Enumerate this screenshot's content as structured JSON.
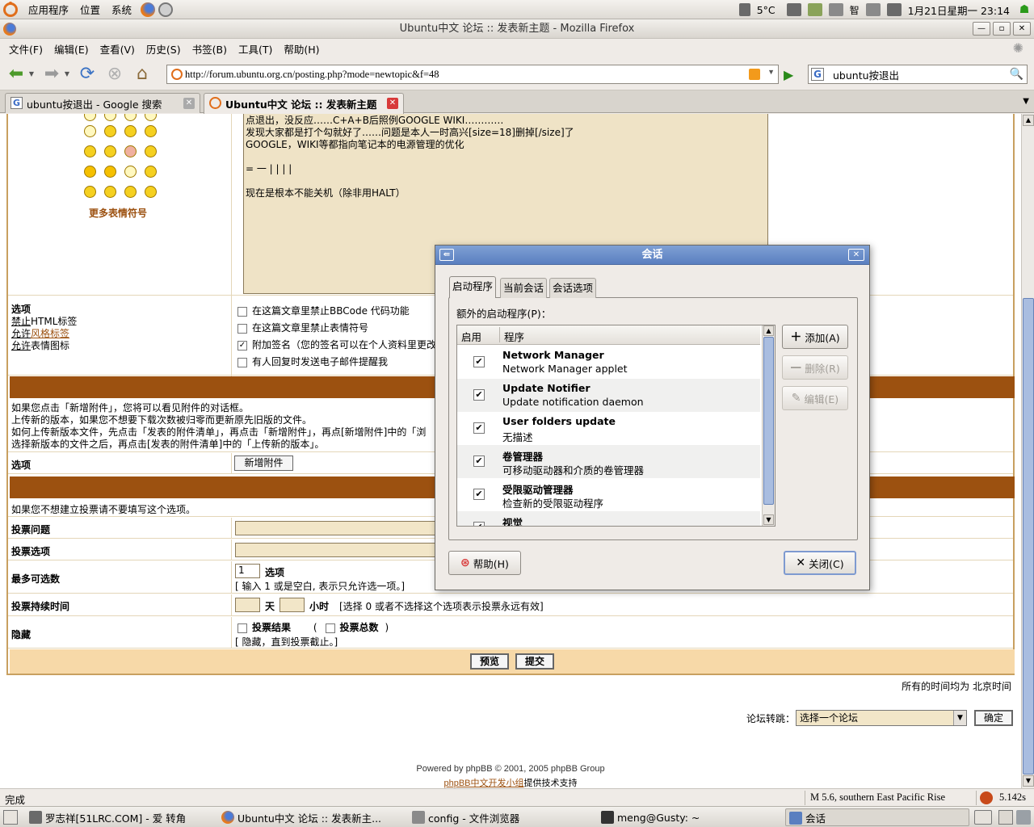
{
  "panel": {
    "menus": [
      "应用程序",
      "位置",
      "系统"
    ],
    "temperature": "5°C",
    "clock": "1月21日星期一 23:14"
  },
  "firefox": {
    "title": "Ubuntu中文 论坛 :: 发表新主题 - Mozilla Firefox",
    "menus": [
      "文件(F)",
      "编辑(E)",
      "查看(V)",
      "历史(S)",
      "书签(B)",
      "工具(T)",
      "帮助(H)"
    ],
    "url": "http://forum.ubuntu.org.cn/posting.php?mode=newtopic&f=48",
    "search_value": "ubuntu按退出",
    "tabs": [
      {
        "label": "ubuntu按退出 - Google 搜索",
        "active": false
      },
      {
        "label": "Ubuntu中文 论坛 :: 发表新主题",
        "active": true
      }
    ],
    "status": "完成",
    "status_quake": "M 5.6, southern East Pacific Rise",
    "status_timer": "5.142s"
  },
  "page": {
    "more_smilies": "更多表情符号",
    "editor_lines": [
      "点退出，没反应……C+A+B后照例GOOGLE WIKI…………",
      "发现大家都是打个勾就好了……问题是本人一时高兴[size=18]删掉[/size]了",
      "GOOGLE，WIKI等都指向笔记本的电源管理的优化",
      "",
      "= 一 | | | |",
      "",
      "现在是根本不能关机（除非用HALT）"
    ],
    "options_label": "选项",
    "html_disabled": "禁止",
    "html_label": "HTML标签",
    "bbcode_enabled": "允许",
    "bbcode_label": "风格标签",
    "smilies_enabled": "允许",
    "smilies_label": "表情图标",
    "opt1": "在这篇文章里禁止BBCode 代码功能",
    "opt2": "在这篇文章里禁止表情符号",
    "opt3": "附加签名（您的签名可以在个人资料里更改",
    "opt4": "有人回复时发送电子邮件提醒我",
    "attach_info": [
      "如果您点击「新增附件」，您将可以看见附件的对话框。",
      "上传新的版本，如果您不想要下载次数被归零而更新原先旧版的文件。",
      "如何上传新版本文件，先点击「发表的附件清单」，再点击「新增附件」，再点[新增附件]中的「浏",
      "选择新版本的文件之后，再点击[发表的附件清单]中的「上传新的版本」。"
    ],
    "attach_options": "选项",
    "add_attachment_btn": "新增附件",
    "poll_info": "如果您不想建立投票请不要填写这个选项。",
    "poll_question": "投票问题",
    "poll_option": "投票选项",
    "max_options": "最多可选数",
    "max_options_value": "1",
    "max_options_unit": "选项",
    "max_options_hint": "[ 输入 1 或是空白, 表示只允许选一项。]",
    "poll_length": "投票持续时间",
    "days": "天",
    "hours": "小时",
    "poll_length_hint": "[选择 0 或者不选择这个选项表示投票永远有效]",
    "hide": "隐藏",
    "hide_results": "投票结果",
    "hide_paren_open": "(",
    "hide_totals": "投票总数",
    "hide_paren_close": ")",
    "hide_hint": "[ 隐藏，直到投票截止。]",
    "preview_btn": "预览",
    "submit_btn": "提交",
    "timezone": "所有的时间均为 北京时间",
    "jump_label": "论坛转跳：",
    "jump_select": "选择一个论坛",
    "jump_go": "确定",
    "powered": "Powered by phpBB © 2001, 2005 phpBB Group",
    "support_link": "phpBB中文开发小组",
    "support_suffix": "提供技术支持"
  },
  "dialog": {
    "title": "会话",
    "tabs": [
      "启动程序",
      "当前会话",
      "会话选项"
    ],
    "extra_label": "额外的启动程序(P)：",
    "col_enable": "启用",
    "col_program": "程序",
    "rows": [
      {
        "name": "Network Manager",
        "desc": "Network Manager applet",
        "checked": "✔"
      },
      {
        "name": "Update Notifier",
        "desc": "Update notification daemon",
        "checked": "✔"
      },
      {
        "name": "User folders update",
        "desc": "无描述",
        "checked": "✔"
      },
      {
        "name": "卷管理器",
        "desc": "可移动驱动器和介质的卷管理器",
        "checked": "✔"
      },
      {
        "name": "受限驱动管理器",
        "desc": "检查新的受限驱动程序",
        "checked": "✔"
      },
      {
        "name": "视觉",
        "desc": "",
        "checked": "✔"
      }
    ],
    "add_btn": "添加(A)",
    "remove_btn": "删除(R)",
    "edit_btn": "编辑(E)",
    "help_btn": "帮助(H)",
    "close_btn": "关闭(C)"
  },
  "taskbar": {
    "tasks": [
      {
        "label": "罗志祥[51LRC.COM] - 爱 转角"
      },
      {
        "label": "Ubuntu中文 论坛 :: 发表新主..."
      },
      {
        "label": "config - 文件浏览器"
      },
      {
        "label": "meng@Gusty: ~"
      },
      {
        "label": "会话"
      }
    ]
  },
  "colors": {
    "forum_orange": "#9c5110",
    "input_tan": "#f2e6c8",
    "dialog_title": "#5a7fc0"
  }
}
